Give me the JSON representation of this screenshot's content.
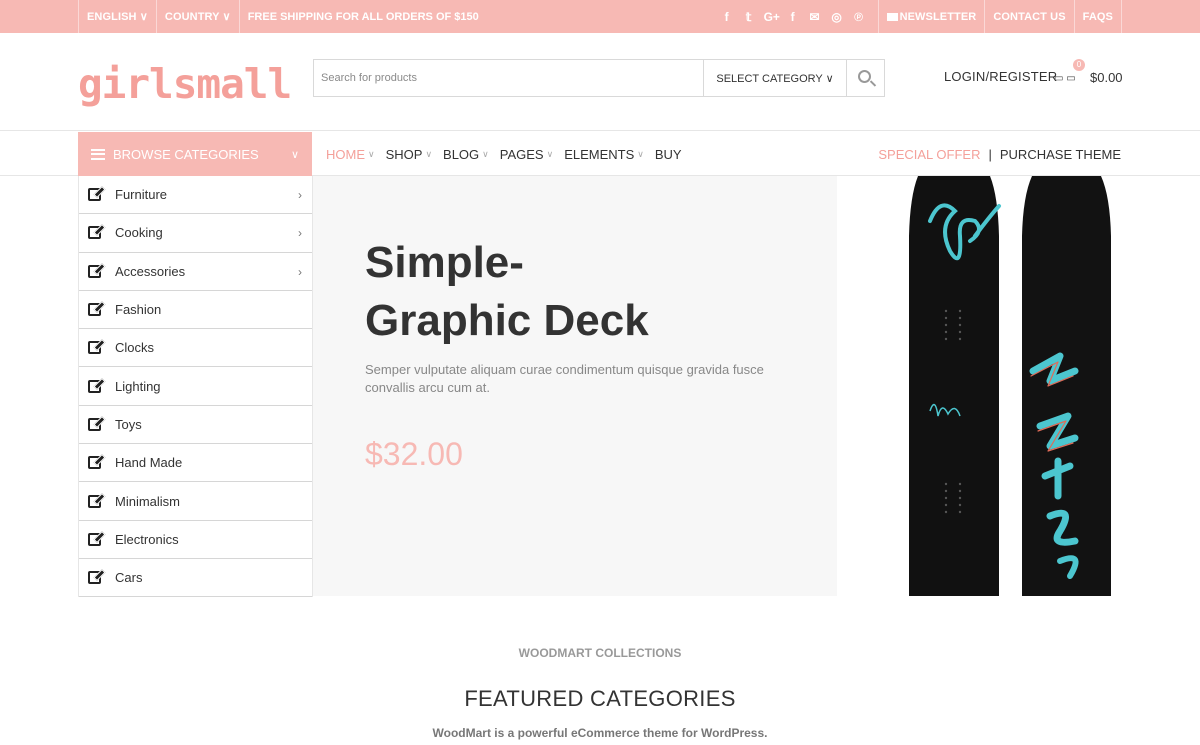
{
  "topbar": {
    "language": "ENGLISH ∨",
    "country": "COUNTRY ∨",
    "shipping": "FREE SHIPPING FOR ALL ORDERS OF $150",
    "social_icons": [
      "facebook-icon",
      "twitter-icon",
      "google-plus-icon",
      "facebook-icon",
      "mail-icon",
      "instagram-icon",
      "pinterest-icon"
    ],
    "social_glyphs": [
      "f",
      "𝕥",
      "G+",
      "f",
      "✉",
      "◎",
      "℗"
    ],
    "newsletter": "NEWSLETTER",
    "contact": "CONTACT US",
    "faqs": "FAQS"
  },
  "header": {
    "logo": "girlsmall",
    "search_placeholder": "Search for products",
    "select_category": "SELECT CATEGORY ∨",
    "login": "LOGIN/REGISTER",
    "cart_glyphs": "▭  ▭",
    "cart_count": "0",
    "cart_total": "$0.00"
  },
  "nav": {
    "browse": "BROWSE CATEGORIES",
    "browse_chevron": "∨",
    "items": [
      {
        "label": "HOME",
        "chevron": "∨",
        "active": true
      },
      {
        "label": "SHOP",
        "chevron": "∨"
      },
      {
        "label": "BLOG",
        "chevron": "∨"
      },
      {
        "label": "PAGES",
        "chevron": "∨"
      },
      {
        "label": "ELEMENTS",
        "chevron": "∨"
      },
      {
        "label": "BUY",
        "chevron": ""
      }
    ],
    "special_offer": "SPECIAL OFFER",
    "separator": "|",
    "purchase": "PURCHASE THEME"
  },
  "sidebar": {
    "categories": [
      {
        "label": "Furniture",
        "arrow": "›"
      },
      {
        "label": "Cooking",
        "arrow": "›"
      },
      {
        "label": "Accessories",
        "arrow": "›"
      },
      {
        "label": "Fashion",
        "arrow": ""
      },
      {
        "label": "Clocks",
        "arrow": ""
      },
      {
        "label": "Lighting",
        "arrow": ""
      },
      {
        "label": "Toys",
        "arrow": ""
      },
      {
        "label": "Hand Made",
        "arrow": ""
      },
      {
        "label": "Minimalism",
        "arrow": ""
      },
      {
        "label": "Electronics",
        "arrow": ""
      },
      {
        "label": "Cars",
        "arrow": ""
      }
    ]
  },
  "hero": {
    "title_line1": "Simple-",
    "title_line2": "Graphic Deck",
    "description": "Semper vulputate aliquam curae condimentum quisque gravida fusce convallis arcu cum at.",
    "price": "$32.00"
  },
  "section": {
    "subtitle": "WOODMART COLLECTIONS",
    "title": "FEATURED CATEGORIES",
    "description": "WoodMart is a powerful eCommerce theme for WordPress."
  },
  "colors": {
    "accent": "#f7b9b4",
    "accent_text": "#f4a09a",
    "board_color": "#111111",
    "board_graphic": "#4cc6cf"
  }
}
